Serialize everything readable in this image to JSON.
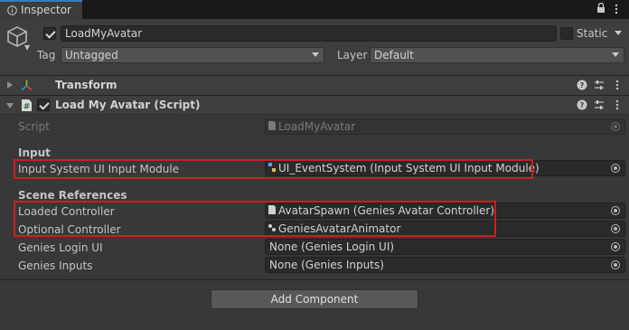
{
  "window": {
    "tab_title": "Inspector"
  },
  "header": {
    "object_name": "LoadMyAvatar",
    "static_label": "Static",
    "tag_label": "Tag",
    "tag_value": "Untagged",
    "layer_label": "Layer",
    "layer_value": "Default",
    "active_checked": true,
    "static_checked": false
  },
  "components": {
    "transform": {
      "title": "Transform"
    },
    "script": {
      "title": "Load My Avatar (Script)",
      "enabled": true
    }
  },
  "fields": {
    "script": {
      "label": "Script",
      "value": "LoadMyAvatar"
    },
    "input_section": "Input",
    "input_module": {
      "label": "Input System UI Input Module",
      "value": "UI_EventSystem (Input System UI Input Module)"
    },
    "scene_section": "Scene References",
    "loaded_controller": {
      "label": "Loaded Controller",
      "value": "AvatarSpawn (Genies Avatar Controller)"
    },
    "optional_controller": {
      "label": "Optional Controller",
      "value": "GeniesAvatarAnimator"
    },
    "login_ui": {
      "label": "Genies Login UI",
      "value": "None (Genies Login UI)"
    },
    "inputs": {
      "label": "Genies Inputs",
      "value": "None (Genies Inputs)"
    }
  },
  "buttons": {
    "add_component": "Add Component"
  },
  "icons": {
    "tab": "info-icon",
    "lock": "lock-icon",
    "menu": "kebab-menu-icon",
    "gameobject": "cube-icon",
    "transform": "transform-axes-icon",
    "script": "script-hash-icon",
    "help": "help-icon",
    "presets": "presets-icon",
    "more": "more-icon",
    "object_picker": "object-picker-icon"
  },
  "colors": {
    "background": "#383838",
    "tabbar": "#191919",
    "accent": "#3a79bb",
    "highlight_box": "#cc1f1f"
  }
}
